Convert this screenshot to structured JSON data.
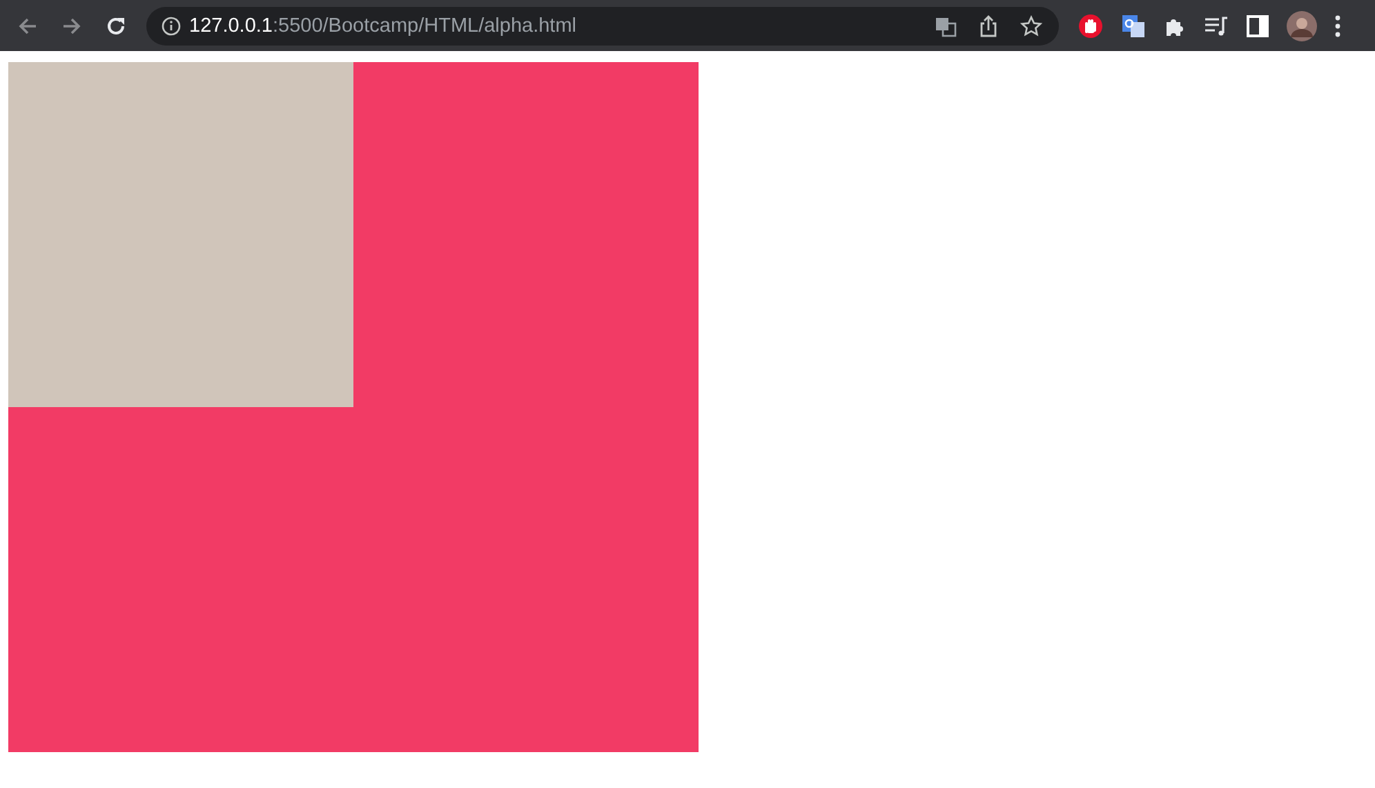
{
  "address_bar": {
    "host": "127.0.0.1",
    "path": ":5500/Bootcamp/HTML/alpha.html"
  }
}
